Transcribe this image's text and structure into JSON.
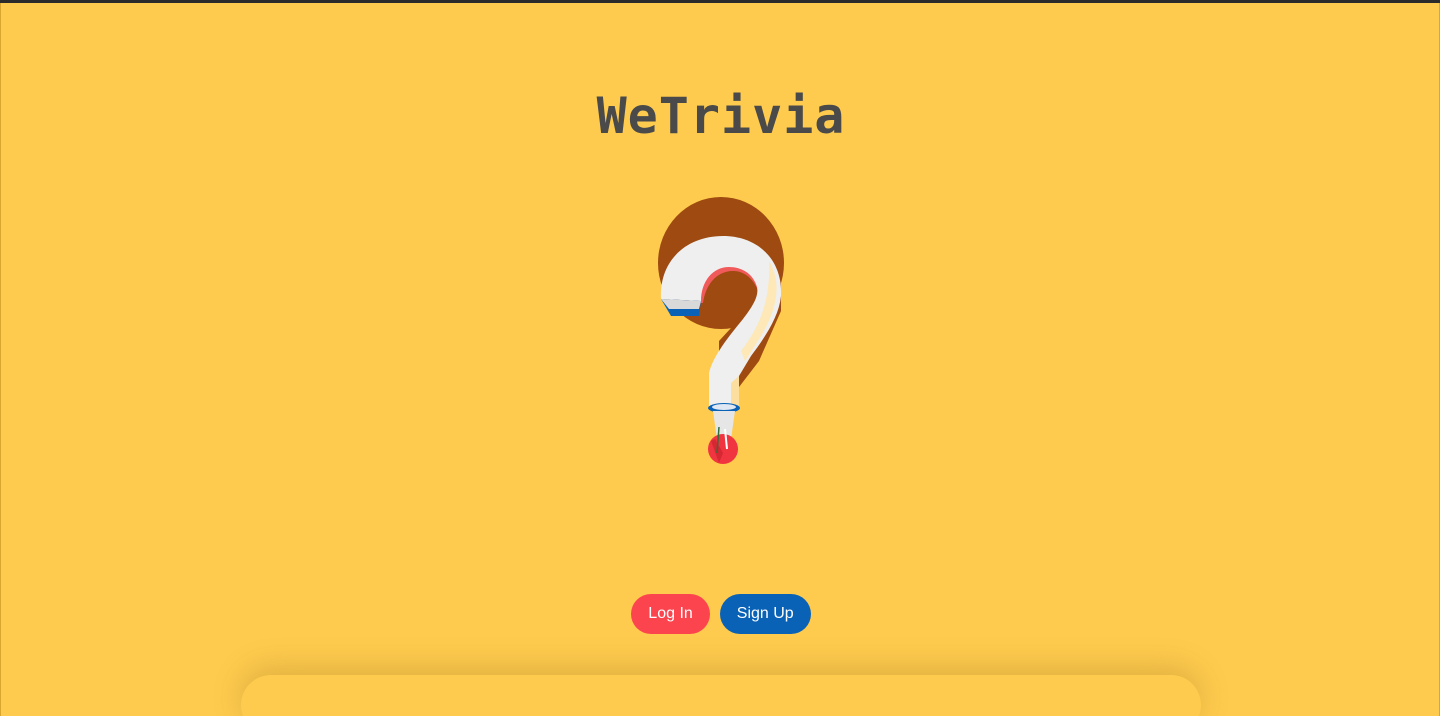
{
  "app": {
    "title": "WeTrivia",
    "logo_icon": "question-mark-icon"
  },
  "actions": {
    "login_label": "Log In",
    "signup_label": "Sign Up"
  },
  "colors": {
    "background": "#fecb4e",
    "title_text": "#4a4a4a",
    "login_button": "#fc444f",
    "signup_button": "#0a62b6"
  }
}
